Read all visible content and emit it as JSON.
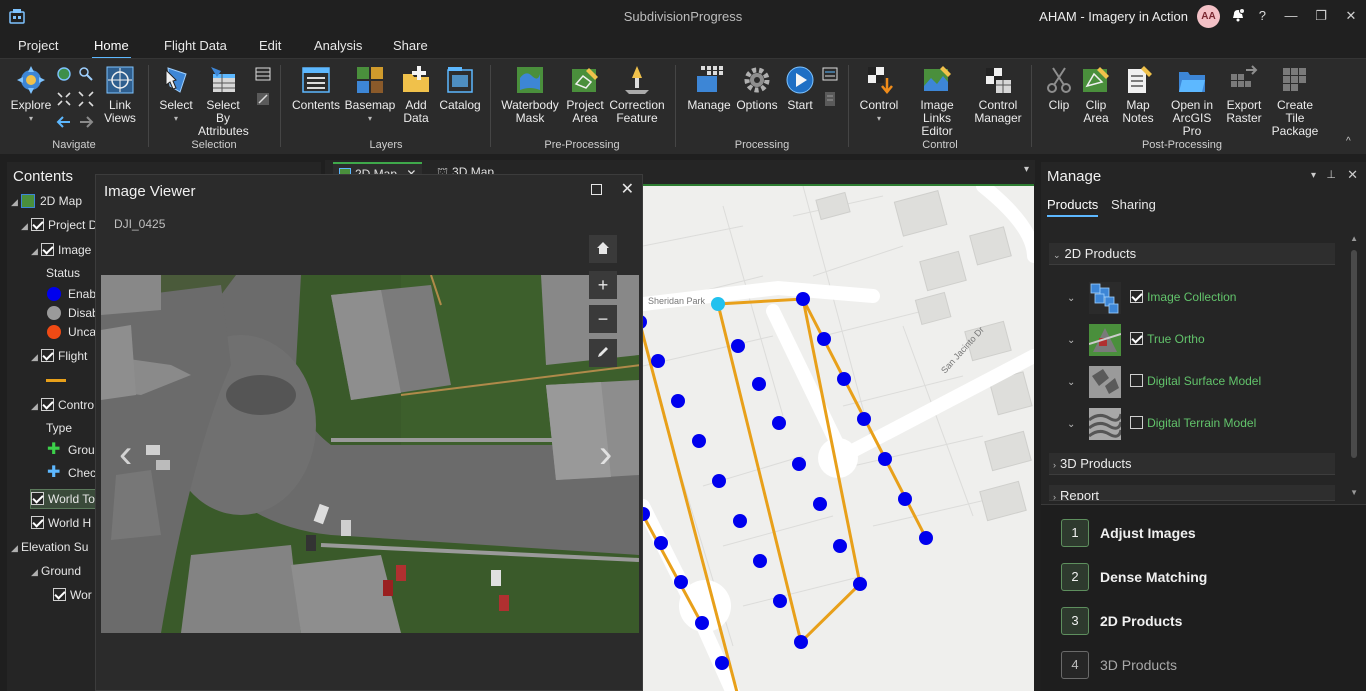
{
  "titlebar": {
    "window_title": "SubdivisionProgress",
    "user_name": "AHAM - Imagery in Action",
    "avatar_initials": "AA",
    "help": "?"
  },
  "ribbon_tabs": [
    "Project",
    "Home",
    "Flight Data",
    "Edit",
    "Analysis",
    "Share"
  ],
  "ribbon": {
    "navigate": {
      "label": "Navigate",
      "explore": "Explore",
      "link_views": "Link\nViews"
    },
    "selection": {
      "label": "Selection",
      "select": "Select",
      "select_by_attributes": "Select By\nAttributes"
    },
    "layers": {
      "label": "Layers",
      "contents": "Contents",
      "basemap": "Basemap",
      "add_data": "Add\nData",
      "catalog": "Catalog"
    },
    "preprocessing": {
      "label": "Pre-Processing",
      "waterbody_mask": "Waterbody\nMask",
      "project_area": "Project\nArea",
      "correction_feature": "Correction\nFeature"
    },
    "processing": {
      "label": "Processing",
      "manage": "Manage",
      "options": "Options",
      "start": "Start"
    },
    "control": {
      "label": "Control",
      "control": "Control",
      "image_links_editor": "Image\nLinks Editor",
      "control_manager": "Control\nManager"
    },
    "postprocessing": {
      "label": "Post-Processing",
      "clip": "Clip",
      "clip_area": "Clip\nArea",
      "map_notes": "Map\nNotes",
      "open_in_pro": "Open in\nArcGIS Pro",
      "export_raster": "Export\nRaster",
      "create_tile_package": "Create Tile\nPackage"
    }
  },
  "contents": {
    "title": "Contents",
    "rows": {
      "map": "2D Map",
      "project_data": "Project D",
      "image": "Image",
      "status": "Status",
      "enabled": "Enab",
      "disabled": "Disab",
      "uncalc": "Unca",
      "flight": "Flight",
      "control": "Contro",
      "type": "Type",
      "ground": "Grou",
      "check": "Chec",
      "world_to": "World To",
      "world_h": "World H",
      "elevation": "Elevation Su",
      "ground2": "Ground",
      "wor": "Wor"
    }
  },
  "map_tabs": {
    "tab_2d": "2D Map",
    "tab_3d": "3D Map"
  },
  "image_viewer": {
    "title": "Image Viewer",
    "filename": "DJI_0425"
  },
  "map": {
    "street1": "Sheridan Park",
    "street2": "San Jacinto Dr"
  },
  "manage": {
    "title": "Manage",
    "tabs": [
      "Products",
      "Sharing"
    ],
    "sections": {
      "products_2d": "2D Products",
      "products_3d": "3D Products",
      "report": "Report"
    },
    "products": [
      {
        "name": "Image Collection",
        "checked": true
      },
      {
        "name": "True Ortho",
        "checked": true
      },
      {
        "name": "Digital Surface Model",
        "checked": false
      },
      {
        "name": "Digital Terrain Model",
        "checked": false
      }
    ],
    "steps": [
      {
        "num": "1",
        "label": "Adjust Images"
      },
      {
        "num": "2",
        "label": "Dense Matching"
      },
      {
        "num": "3",
        "label": "2D Products"
      },
      {
        "num": "4",
        "label": "3D Products"
      }
    ]
  },
  "colors": {
    "accent": "#5db8ff",
    "green": "#62c36b",
    "flight_line": "#e8a01a",
    "point": "#0000ee",
    "point_selected": "#22c1ee"
  }
}
